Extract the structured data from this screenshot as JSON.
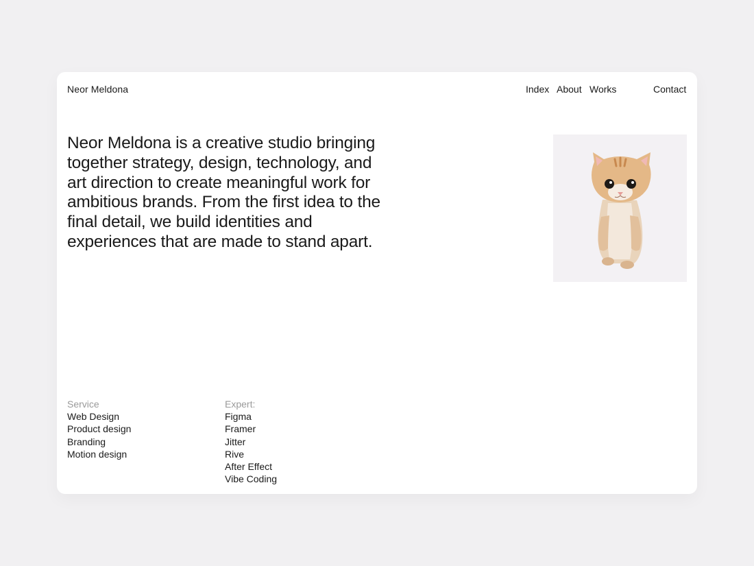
{
  "header": {
    "brand": "Neor Meldona",
    "nav": {
      "index": "Index",
      "about": "About",
      "works": "Works",
      "contact": "Contact"
    }
  },
  "intro": {
    "text": "Neor Meldona is a creative studio bringing together strategy, design, technology, and art direction to create meaningful work for ambitious brands. From the first idea to the final detail, we build identities and experiences that are made to stand apart."
  },
  "image": {
    "subject": "kitten-photo"
  },
  "services": {
    "heading": "Service",
    "items": [
      "Web Design",
      "Product design",
      "Branding",
      "Motion design"
    ]
  },
  "expertise": {
    "heading": "Expert:",
    "items": [
      "Figma",
      "Framer",
      "Jitter",
      "Rive",
      "After Effect",
      "Vibe Coding"
    ]
  },
  "colors": {
    "page_background": "#f1f0f2",
    "card_background": "#ffffff",
    "text": "#1a1a1a",
    "muted_text": "#9a9a9a"
  }
}
